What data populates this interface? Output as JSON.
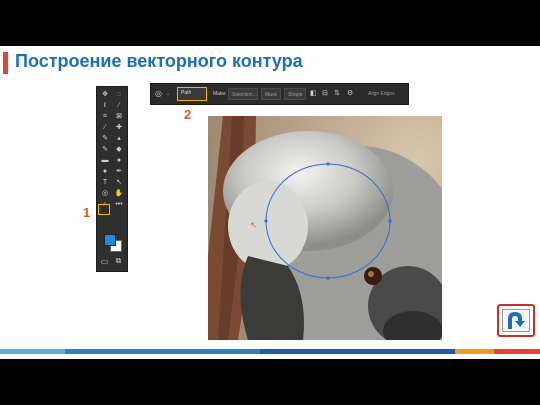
{
  "slide": {
    "title": "Построение векторного контура",
    "accent_color": "#e8413a",
    "title_color": "#1a6fb5"
  },
  "annotations": {
    "label_1": "1",
    "label_2": "2",
    "color": "#e25a1c"
  },
  "toolbar": {
    "icons": [
      "move-icon",
      "marquee-icon",
      "lasso-icon",
      "magic-wand-icon",
      "crop-icon",
      "frame-icon",
      "eyedropper-icon",
      "healing-brush-icon",
      "brush-icon",
      "clone-stamp-icon",
      "history-brush-icon",
      "eraser-icon",
      "gradient-icon",
      "blur-icon",
      "dodge-icon",
      "pen-icon",
      "type-icon",
      "path-selection-icon",
      "ellipse-icon",
      "hand-icon",
      "zoom-icon",
      "more-icon"
    ],
    "selected_tool": "ellipse-icon",
    "foreground_color": "#1e8be0",
    "background_color": "#ffffff"
  },
  "options_bar": {
    "mode": "Path",
    "make_label": "Make:",
    "selection_button": "Selection...",
    "mask_button": "Mask",
    "shape_button": "Shape",
    "align_edges": "Align Edges"
  },
  "return_button": {
    "icon": "return-arrow-icon",
    "color": "#1a6fb5"
  },
  "footer_colors": [
    "#5aaee0",
    "#2f7fc2",
    "#1a5fa3",
    "#f29b1d",
    "#e8413a"
  ]
}
